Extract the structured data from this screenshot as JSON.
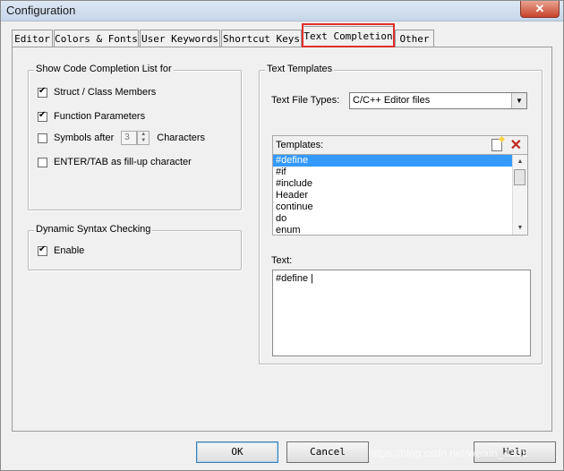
{
  "window": {
    "title": "Configuration",
    "close_glyph": "✕"
  },
  "tabs": [
    {
      "label": "Editor"
    },
    {
      "label": "Colors & Fonts"
    },
    {
      "label": "User Keywords"
    },
    {
      "label": "Shortcut Keys"
    },
    {
      "label": "Text Completion"
    },
    {
      "label": "Other"
    }
  ],
  "completion_group": {
    "title": "Show Code Completion List for",
    "struct_members": "Struct / Class Members",
    "function_params": "Function Parameters",
    "symbols_after": "Symbols after",
    "symbols_count": "3",
    "characters": "Characters",
    "enter_tab": "ENTER/TAB as fill-up character"
  },
  "syntax_group": {
    "title": "Dynamic Syntax Checking",
    "enable": "Enable"
  },
  "templates_group": {
    "title": "Text Templates",
    "file_types_label": "Text File Types:",
    "file_types_value": "C/C++ Editor files",
    "templates_label": "Templates:",
    "items": [
      "#define",
      "#if",
      "#include",
      "Header",
      "continue",
      "do",
      "enum"
    ],
    "text_label": "Text:",
    "text_value": "#define |"
  },
  "buttons": {
    "ok": "OK",
    "cancel": "Cancel",
    "help": "Help"
  },
  "watermark": "https://blog.csdn.net/weixin_4332"
}
